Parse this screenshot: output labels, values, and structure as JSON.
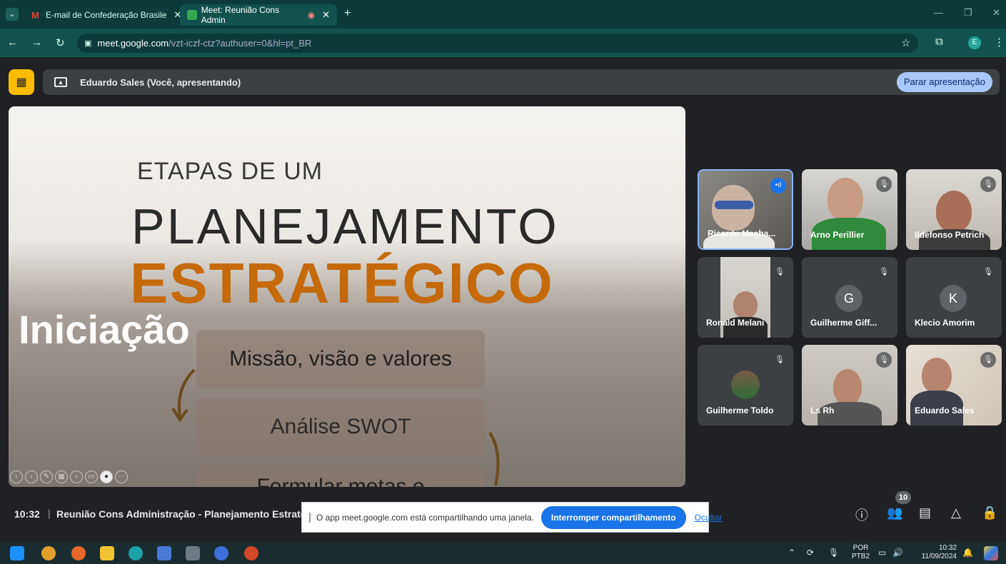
{
  "browser": {
    "tabs": [
      {
        "label": "E-mail de Confederação Brasile",
        "close": "✕"
      },
      {
        "label": "Meet: Reunião Cons Admin",
        "close": "✕"
      }
    ],
    "new_tab": "+",
    "url_host": "meet.google.com",
    "url_path": "/vzt-iczf-ctz?authuser=0&hl=pt_BR",
    "profile_initial": "E"
  },
  "meet": {
    "presenter_label": "Eduardo Sales (Você, apresentando)",
    "stop_presenting": "Parar apresentação",
    "time": "10:32",
    "separator": "|",
    "meeting_title": "Reunião Cons Administração - Planejamento Estratégico",
    "people_count": "10",
    "participants": [
      {
        "name": "Ricardo Macha...",
        "speaking": true
      },
      {
        "name": "Arno Perillier",
        "muted": true
      },
      {
        "name": "Ildefonso Petrich",
        "muted": true
      },
      {
        "name": "Ronald Melani",
        "muted": true
      },
      {
        "name": "Guilherme Giff...",
        "initial": "G",
        "avatar_color": "#5f6368",
        "muted": true
      },
      {
        "name": "Klecio Amorim",
        "initial": "K",
        "avatar_color": "#5f6368",
        "muted": true
      },
      {
        "name": "Guilherme Toldo",
        "muted": true
      },
      {
        "name": "Ls Rh",
        "muted": true
      },
      {
        "name": "Eduardo Sales",
        "muted": true
      }
    ]
  },
  "slide": {
    "title_small": "ETAPAS DE UM",
    "title_large": "PLANEJAMENTO",
    "title_accent": "ESTRATÉGICO",
    "overlay": "Iniciação",
    "steps": [
      "Missão, visão e valores",
      "Análise SWOT",
      "Formular metas e"
    ]
  },
  "share_notice": {
    "text": "O app meet.google.com está compartilhando uma janela.",
    "stop": "Interromper compartilhamento",
    "hide": "Ocultar"
  },
  "taskbar": {
    "lang_top": "POR",
    "lang_bottom": "PTB2",
    "time": "10:32",
    "date": "11/09/2024"
  },
  "colors": {
    "accent": "#c46a0c",
    "chrome": "#0b3c3a",
    "meet_bg": "#202124",
    "present_button": "#a8c7fa"
  }
}
